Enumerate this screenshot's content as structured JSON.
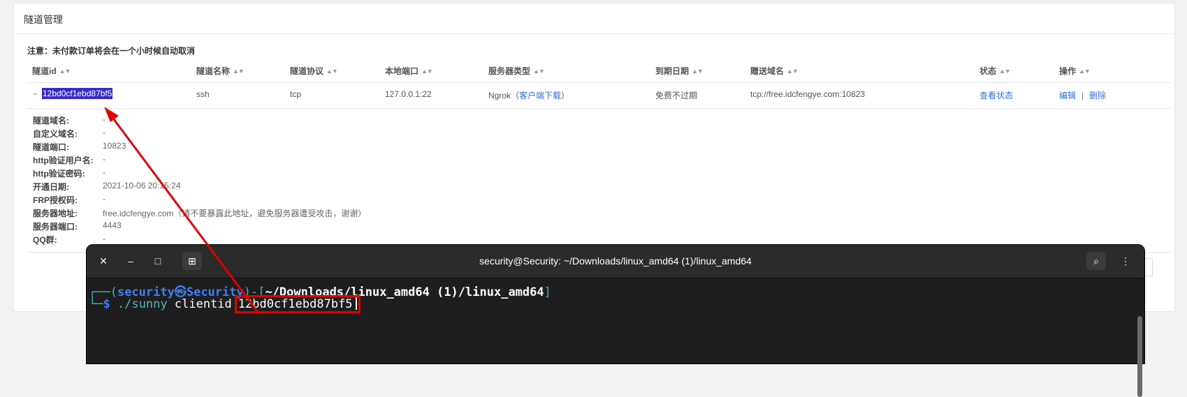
{
  "panel": {
    "title": "隧道管理",
    "notice": "注意：未付款订单将会在一个小时候自动取消"
  },
  "columns": [
    "隧道id",
    "隧道名称",
    "隧道协议",
    "本地端口",
    "服务器类型",
    "到期日期",
    "赠送域名",
    "状态",
    "操作"
  ],
  "row": {
    "id": "12bd0cf1ebd87bf5",
    "name": "ssh",
    "protocol": "tcp",
    "local_port": "127.0.0.1:22",
    "server_type": "Ngrok",
    "client_download_pre": "（",
    "client_download": "客户端下载",
    "client_download_post": "）",
    "expiry": "免费不过期",
    "domain": "tcp://free.idcfengye.com:10823",
    "status_link": "查看状态",
    "edit": "编辑",
    "separator": "|",
    "delete": "删除"
  },
  "details": [
    {
      "label": "隧道域名:",
      "value": "-"
    },
    {
      "label": "自定义域名:",
      "value": "-"
    },
    {
      "label": "隧道端口:",
      "value": "10823"
    },
    {
      "label": "http验证用户名:",
      "value": "-"
    },
    {
      "label": "http验证密码:",
      "value": "-"
    },
    {
      "label": "开通日期:",
      "value": "2021-10-06 20:15:24"
    },
    {
      "label": "FRP授权码:",
      "value": "-"
    },
    {
      "label": "服务器地址:",
      "value": "free.idcfengye.com（请不要暴露此地址，避免服务器遭受攻击，谢谢）"
    },
    {
      "label": "服务器端口:",
      "value": "4443"
    },
    {
      "label": "QQ群:",
      "value": "-"
    }
  ],
  "terminal": {
    "title": "security@Security: ~/Downloads/linux_amd64 (1)/linux_amd64",
    "prompt_user": "security",
    "prompt_at": "㉿",
    "prompt_host": "Security",
    "prompt_path": "~/Downloads/linux_amd64 (1)/linux_amd64",
    "prompt_open": "┌──(",
    "prompt_mid": ")-[",
    "prompt_close": "]",
    "prompt_corner": "└─",
    "prompt_dollar": "$",
    "command": "./sunny",
    "arg_label": "clientid",
    "arg_value": "12bd0cf1ebd87bf5",
    "icons": {
      "close": "close-icon",
      "minimize": "minimize-icon",
      "maximize": "maximize-icon",
      "new_tab": "new-tab-icon",
      "search": "search-icon",
      "menu": "kebab-menu-icon"
    }
  },
  "colors": {
    "highlight": "#3a2bc7",
    "annotation": "#e00000",
    "link": "#2f6fd6",
    "terminal_bg": "#1e1e1e"
  }
}
